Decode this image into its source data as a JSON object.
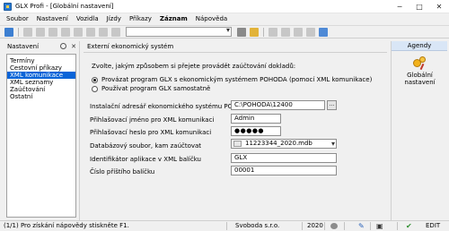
{
  "window": {
    "title": "GLX Profi - [Globální nastavení]",
    "minimize_glyph": "─",
    "maximize_glyph": "□",
    "close_glyph": "✕"
  },
  "menu": {
    "items": [
      "Soubor",
      "Nastavení",
      "Vozidla",
      "Jízdy",
      "Příkazy",
      "Záznam",
      "Nápověda"
    ]
  },
  "left_panel": {
    "title": "Nastavení",
    "items": [
      "Termíny",
      "Cestovní příkazy",
      "XML komunikace",
      "XML seznamy",
      "Zaúčtování",
      "Ostatní"
    ],
    "selected_index": 2
  },
  "content": {
    "section_title": "Externí ekonomický systém",
    "question": "Zvolte, jakým způsobem si přejete provádět zaúčtování dokladů:",
    "radio_1": "Provázat program GLX s ekonomickým systémem POHODA (pomocí XML komunikace)",
    "radio_2": "Používat program GLX samostatně",
    "install_dir_label": "Instalační adresář ekonomického systému POHODA",
    "install_dir_value": "C:\\POHODA\\12400",
    "login_label": "Přihlašovací jméno pro XML komunikaci",
    "login_value": "Admin",
    "password_label": "Přihlašovací heslo pro XML komunikaci",
    "password_value": "●●●●●",
    "dbfile_label": "Databázový soubor, kam zaúčtovat",
    "dbfile_value": "11223344_2020.mdb",
    "app_id_label": "Identifikátor aplikace v XML balíčku",
    "app_id_value": "GLX",
    "next_package_label": "Číslo příštího balíčku",
    "next_package_value": "00001",
    "browse_button": "..."
  },
  "right_panel": {
    "title": "Agendy",
    "item_label": "Globální nastavení"
  },
  "status": {
    "help": "(1/1) Pro získání nápovědy stiskněte F1.",
    "company": "Svoboda s.r.o.",
    "year": "2020",
    "mode": "EDIT"
  },
  "colors": {
    "selection": "#0a64d8",
    "agendy_header": "#d9e6f6"
  }
}
